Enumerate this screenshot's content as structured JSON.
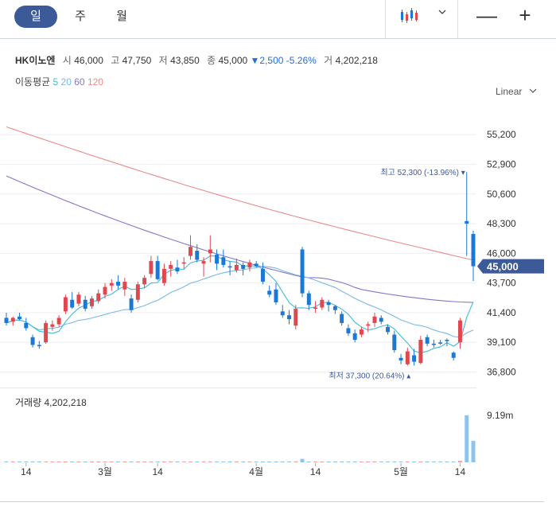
{
  "tabs": [
    "일",
    "주",
    "월"
  ],
  "zoom": {
    "out": "—",
    "in": "+"
  },
  "stock": {
    "name": "HK이노엔",
    "open_label": "시",
    "open": "46,000",
    "high_label": "고",
    "high": "47,750",
    "low_label": "저",
    "low": "43,850",
    "close_label": "종",
    "close": "45,000",
    "change": "▼2,500",
    "change_pct": "-5.26%",
    "volume_label": "거",
    "volume": "4,202,218"
  },
  "ma_legend": {
    "title": "이동평균",
    "periods": [
      "5",
      "20",
      "60",
      "120"
    ]
  },
  "scale_label": "Linear",
  "volume_label": "거래량 4,202,218",
  "colors": {
    "up": "#e0484f",
    "down": "#1a78d6",
    "ma5": "#3fbcd9",
    "ma20": "#79b8e6",
    "ma60": "#8875c6",
    "ma120": "#e98b8b",
    "badge": "#3d5a98"
  },
  "chart_data": {
    "type": "candlestick",
    "y_ticks": [
      "55,200",
      "52,900",
      "50,600",
      "48,300",
      "46,000",
      "43,700",
      "41,400",
      "39,100",
      "36,800"
    ],
    "ylim": [
      35600,
      57000
    ],
    "x_tick_labels": [
      "14",
      "3월",
      "14",
      "4월",
      "14",
      "5월",
      "14"
    ],
    "last_price": "45,000",
    "max_label": "최고 52,300 (-13.96%)",
    "min_label": "최저 37,300 (20.64%)",
    "volume_tick": "9.19m",
    "candles": [
      [
        41000,
        41400,
        40400,
        40600
      ],
      [
        40700,
        41100,
        40400,
        41000
      ],
      [
        41100,
        41400,
        40800,
        40900
      ],
      [
        40600,
        41000,
        40000,
        40200
      ],
      [
        39500,
        39700,
        38700,
        38900
      ],
      [
        38900,
        39200,
        38600,
        38800
      ],
      [
        39100,
        40800,
        39000,
        40600
      ],
      [
        40300,
        40800,
        40000,
        40500
      ],
      [
        40500,
        41200,
        40300,
        41000
      ],
      [
        41500,
        42800,
        41300,
        42600
      ],
      [
        42400,
        43000,
        41700,
        41800
      ],
      [
        42100,
        43000,
        41900,
        42800
      ],
      [
        42400,
        42700,
        41500,
        41700
      ],
      [
        41900,
        42700,
        41700,
        42500
      ],
      [
        42300,
        43200,
        42100,
        42900
      ],
      [
        42800,
        43700,
        42500,
        43400
      ],
      [
        43500,
        44000,
        43100,
        43700
      ],
      [
        43800,
        44300,
        43200,
        43500
      ],
      [
        43200,
        44100,
        42700,
        43800
      ],
      [
        42500,
        42800,
        41400,
        41600
      ],
      [
        42400,
        43800,
        42200,
        43600
      ],
      [
        43600,
        44300,
        43300,
        44100
      ],
      [
        44400,
        45800,
        44100,
        45400
      ],
      [
        45400,
        45800,
        43900,
        44000
      ],
      [
        43700,
        45200,
        43500,
        44800
      ],
      [
        44800,
        45400,
        44200,
        45100
      ],
      [
        44900,
        45500,
        44400,
        44600
      ],
      [
        45200,
        45700,
        44800,
        45300
      ],
      [
        45800,
        47400,
        45500,
        46500
      ],
      [
        46200,
        46700,
        45300,
        45500
      ],
      [
        45200,
        45700,
        44200,
        45400
      ],
      [
        46000,
        47400,
        45300,
        46300
      ],
      [
        45900,
        46300,
        44700,
        45200
      ],
      [
        45700,
        46300,
        44900,
        45100
      ],
      [
        45000,
        45400,
        44300,
        44900
      ],
      [
        44700,
        45600,
        44500,
        45100
      ],
      [
        45100,
        45300,
        44300,
        44800
      ],
      [
        44900,
        45500,
        44600,
        45300
      ],
      [
        45200,
        45400,
        44900,
        45000
      ],
      [
        44800,
        45300,
        43600,
        43800
      ],
      [
        43100,
        43500,
        42600,
        42800
      ],
      [
        43200,
        43700,
        42000,
        42200
      ],
      [
        41500,
        42000,
        41000,
        41200
      ],
      [
        41200,
        41600,
        40500,
        40900
      ],
      [
        40400,
        42000,
        40100,
        41700
      ],
      [
        46300,
        46500,
        42600,
        42900
      ],
      [
        42900,
        43100,
        41600,
        42000
      ],
      [
        41700,
        42300,
        41400,
        41800
      ],
      [
        41800,
        42600,
        41600,
        42400
      ],
      [
        42200,
        42400,
        41500,
        42000
      ],
      [
        41900,
        42000,
        41300,
        41600
      ],
      [
        41300,
        41500,
        40400,
        40600
      ],
      [
        40200,
        40500,
        39600,
        39800
      ],
      [
        39800,
        40100,
        39100,
        39300
      ],
      [
        39700,
        40300,
        39500,
        40100
      ],
      [
        40400,
        40700,
        39900,
        40500
      ],
      [
        40600,
        41400,
        40300,
        41100
      ],
      [
        41000,
        41200,
        40500,
        40700
      ],
      [
        40300,
        40500,
        39700,
        39900
      ],
      [
        39700,
        40000,
        38300,
        38500
      ],
      [
        37900,
        38200,
        37400,
        37700
      ],
      [
        37400,
        38700,
        37300,
        38400
      ],
      [
        38100,
        38600,
        37300,
        37600
      ],
      [
        37500,
        39600,
        37400,
        39300
      ],
      [
        39500,
        39700,
        38800,
        39000
      ],
      [
        39000,
        39300,
        38700,
        38900
      ],
      [
        39100,
        39300,
        38900,
        39000
      ],
      [
        39300,
        39400,
        38800,
        39200
      ],
      [
        38300,
        38400,
        37700,
        37900
      ],
      [
        39100,
        41000,
        38600,
        40800
      ],
      [
        48500,
        52300,
        45800,
        48300
      ],
      [
        47500,
        47750,
        43850,
        45000
      ]
    ],
    "volumes": [
      0.06,
      0.05,
      0.05,
      0.04,
      0.05,
      0.04,
      0.07,
      0.05,
      0.06,
      0.1,
      0.08,
      0.07,
      0.06,
      0.06,
      0.07,
      0.08,
      0.07,
      0.06,
      0.06,
      0.07,
      0.08,
      0.08,
      0.1,
      0.08,
      0.07,
      0.06,
      0.06,
      0.06,
      0.09,
      0.07,
      0.06,
      0.08,
      0.07,
      0.06,
      0.06,
      0.06,
      0.05,
      0.05,
      0.05,
      0.07,
      0.07,
      0.07,
      0.07,
      0.06,
      0.07,
      0.68,
      0.12,
      0.08,
      0.07,
      0.06,
      0.06,
      0.07,
      0.07,
      0.06,
      0.06,
      0.06,
      0.07,
      0.06,
      0.06,
      0.08,
      0.09,
      0.08,
      0.08,
      0.1,
      0.07,
      0.06,
      0.06,
      0.06,
      0.07,
      0.3,
      9.19,
      4.2
    ]
  }
}
